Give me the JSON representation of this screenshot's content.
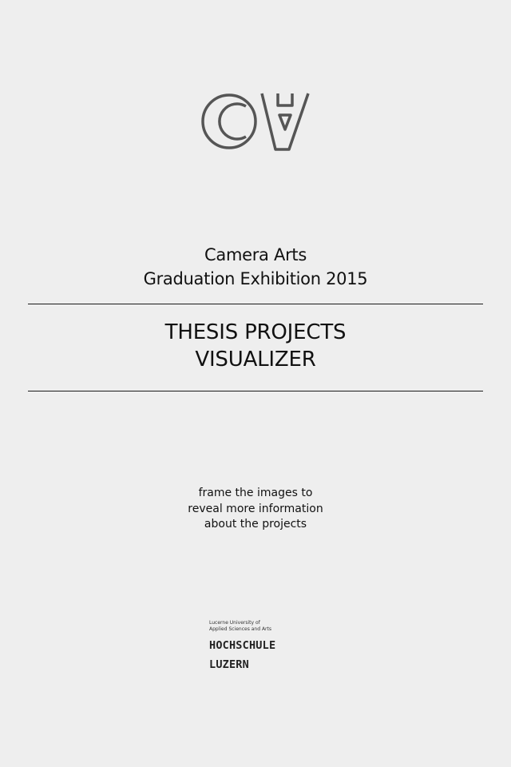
{
  "logo": {
    "label": "CA"
  },
  "subtitle": {
    "line1": "Camera Arts",
    "line2": "Graduation Exhibition 2015"
  },
  "title": {
    "line1": "THESIS PROJECTS",
    "line2": "VISUALIZER"
  },
  "instructions": {
    "line1": "frame the images to",
    "line2": "reveal more information",
    "line3": "about the projects"
  },
  "institution": {
    "tagline_line1": "Lucerne University of",
    "tagline_line2": "Applied Sciences and Arts",
    "name_line1": "HOCHSCHULE",
    "name_line2": "LUZERN"
  }
}
